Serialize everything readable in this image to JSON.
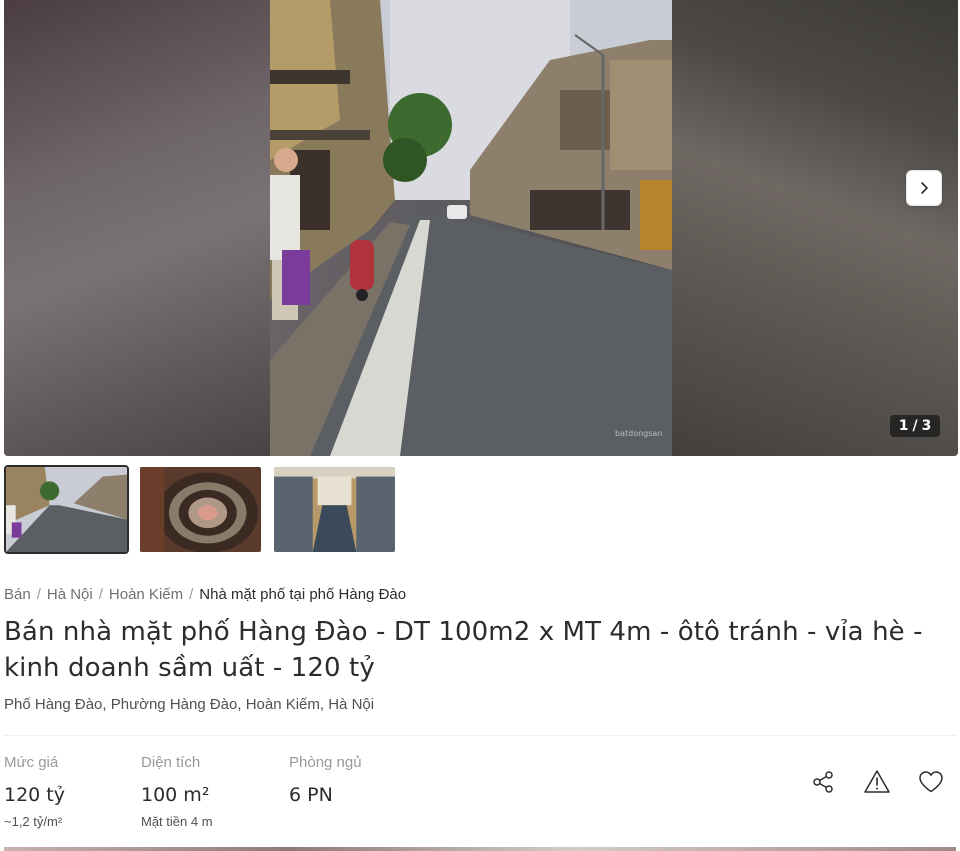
{
  "gallery": {
    "counter_current": "1",
    "counter_separator": "/",
    "counter_total": "3",
    "next_icon": "chevron-right-icon"
  },
  "thumbnails": [
    {
      "description": "street"
    },
    {
      "description": "staircase"
    },
    {
      "description": "shop"
    }
  ],
  "breadcrumb": {
    "items": [
      "Bán",
      "Hà Nội",
      "Hoàn Kiếm"
    ],
    "current": "Nhà mặt phố tại phố Hàng Đào"
  },
  "listing": {
    "title": "Bán nhà mặt phố Hàng Đào - DT 100m2 x MT 4m - ôtô tránh - vỉa hè - kinh doanh sầm uất - 120 tỷ",
    "address": "Phố Hàng Đào, Phường Hàng Đào, Hoàn Kiếm, Hà Nội"
  },
  "stats": {
    "price": {
      "label": "Mức giá",
      "value": "120 tỷ",
      "sub": "~1,2 tỷ/m²"
    },
    "area": {
      "label": "Diện tích",
      "value": "100 m²",
      "sub": "Mặt tiền 4 m"
    },
    "bedrooms": {
      "label": "Phòng ngủ",
      "value": "6 PN"
    }
  },
  "actions": [
    "share-icon",
    "report-icon",
    "heart-icon"
  ],
  "colors": {
    "text": "#2c2c2c",
    "muted": "#999999",
    "secondary": "#505050"
  }
}
